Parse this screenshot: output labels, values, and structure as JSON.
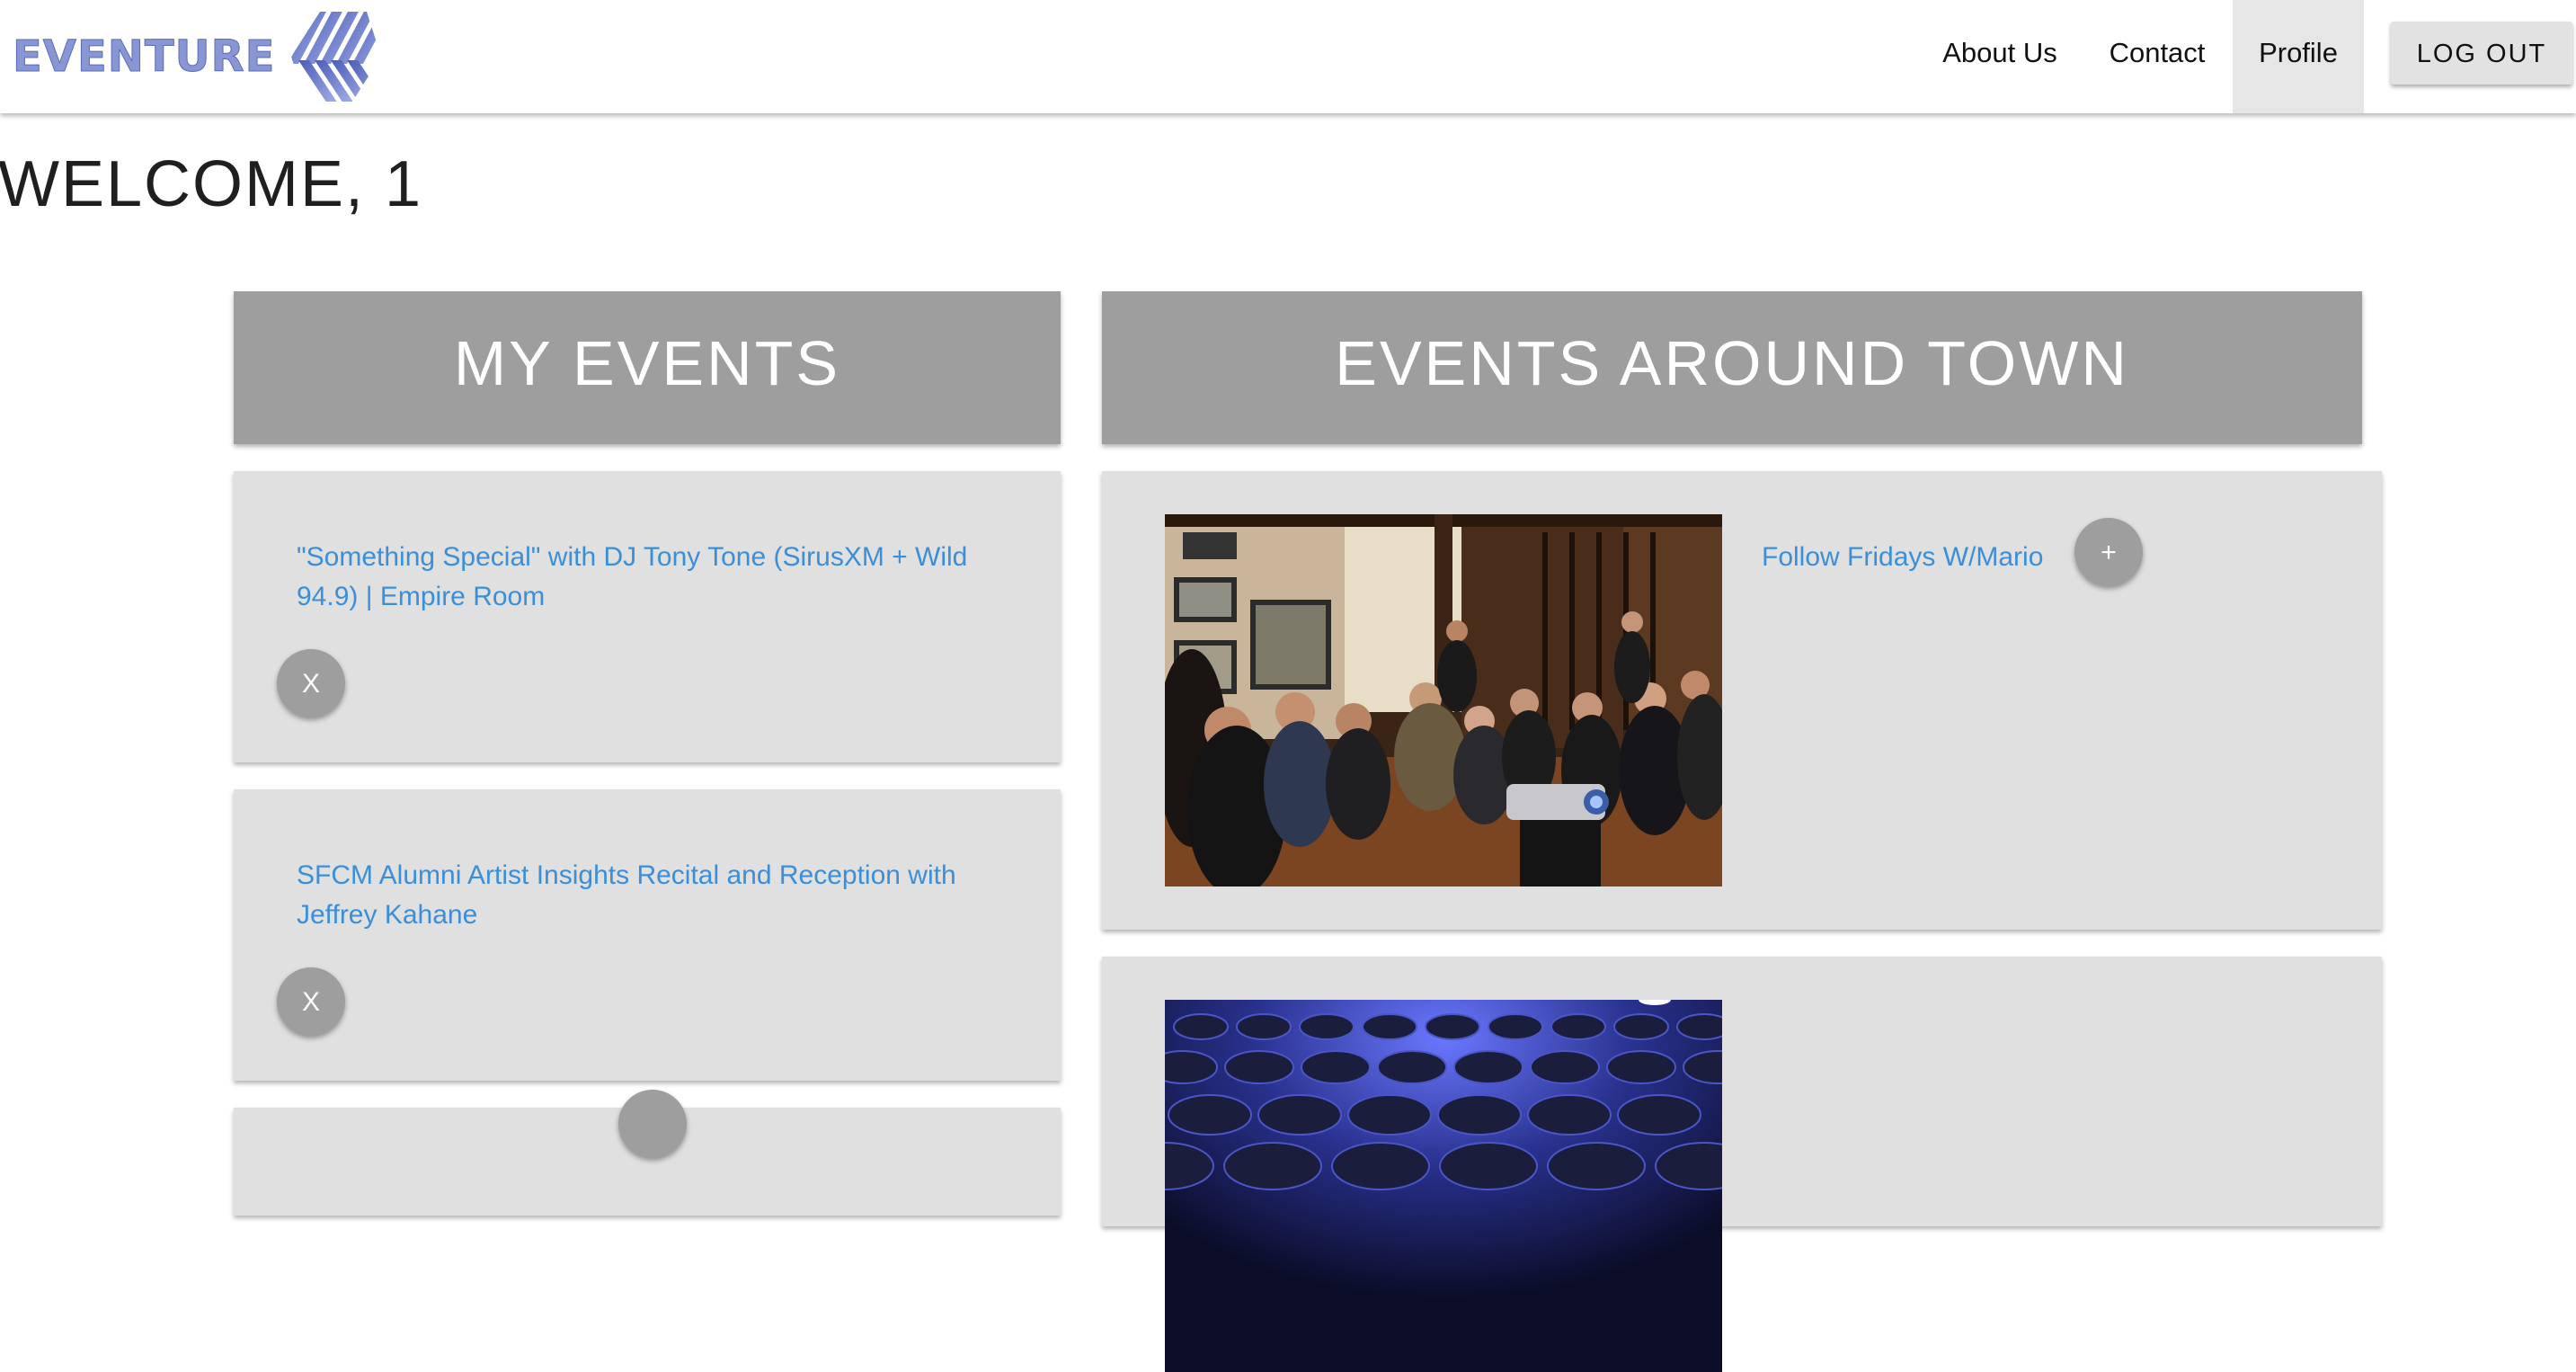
{
  "brand": {
    "name": "EVENTURE",
    "logo_icon": "striped-diamond-logo-icon",
    "color": "#8896d3"
  },
  "nav": {
    "links": [
      "About Us",
      "Contact",
      "Profile"
    ],
    "active": "Profile",
    "logout_label": "LOG OUT"
  },
  "welcome": {
    "text": "WELCOME, 1"
  },
  "my_events": {
    "heading": "MY EVENTS",
    "items": [
      {
        "title": "\"Something Special\" with DJ Tony Tone (SirusXM + Wild 94.9) | Empire Room",
        "remove_label": "X"
      },
      {
        "title": "SFCM Alumni Artist Insights Recital and Reception with Jeffrey Kahane",
        "remove_label": "X"
      }
    ]
  },
  "events_around_town": {
    "heading": "EVENTS AROUND TOWN",
    "items": [
      {
        "title": "Follow Fridays W/Mario",
        "add_label": "+",
        "image": "audience-in-gallery-photo"
      },
      {
        "title": "",
        "image": "blue-auditorium-seats-photo"
      }
    ]
  },
  "colors": {
    "card_header": "#9e9e9e",
    "card_body": "#e0e0e0",
    "link": "#3b8fd9",
    "active_nav": "#e6e6e6"
  }
}
